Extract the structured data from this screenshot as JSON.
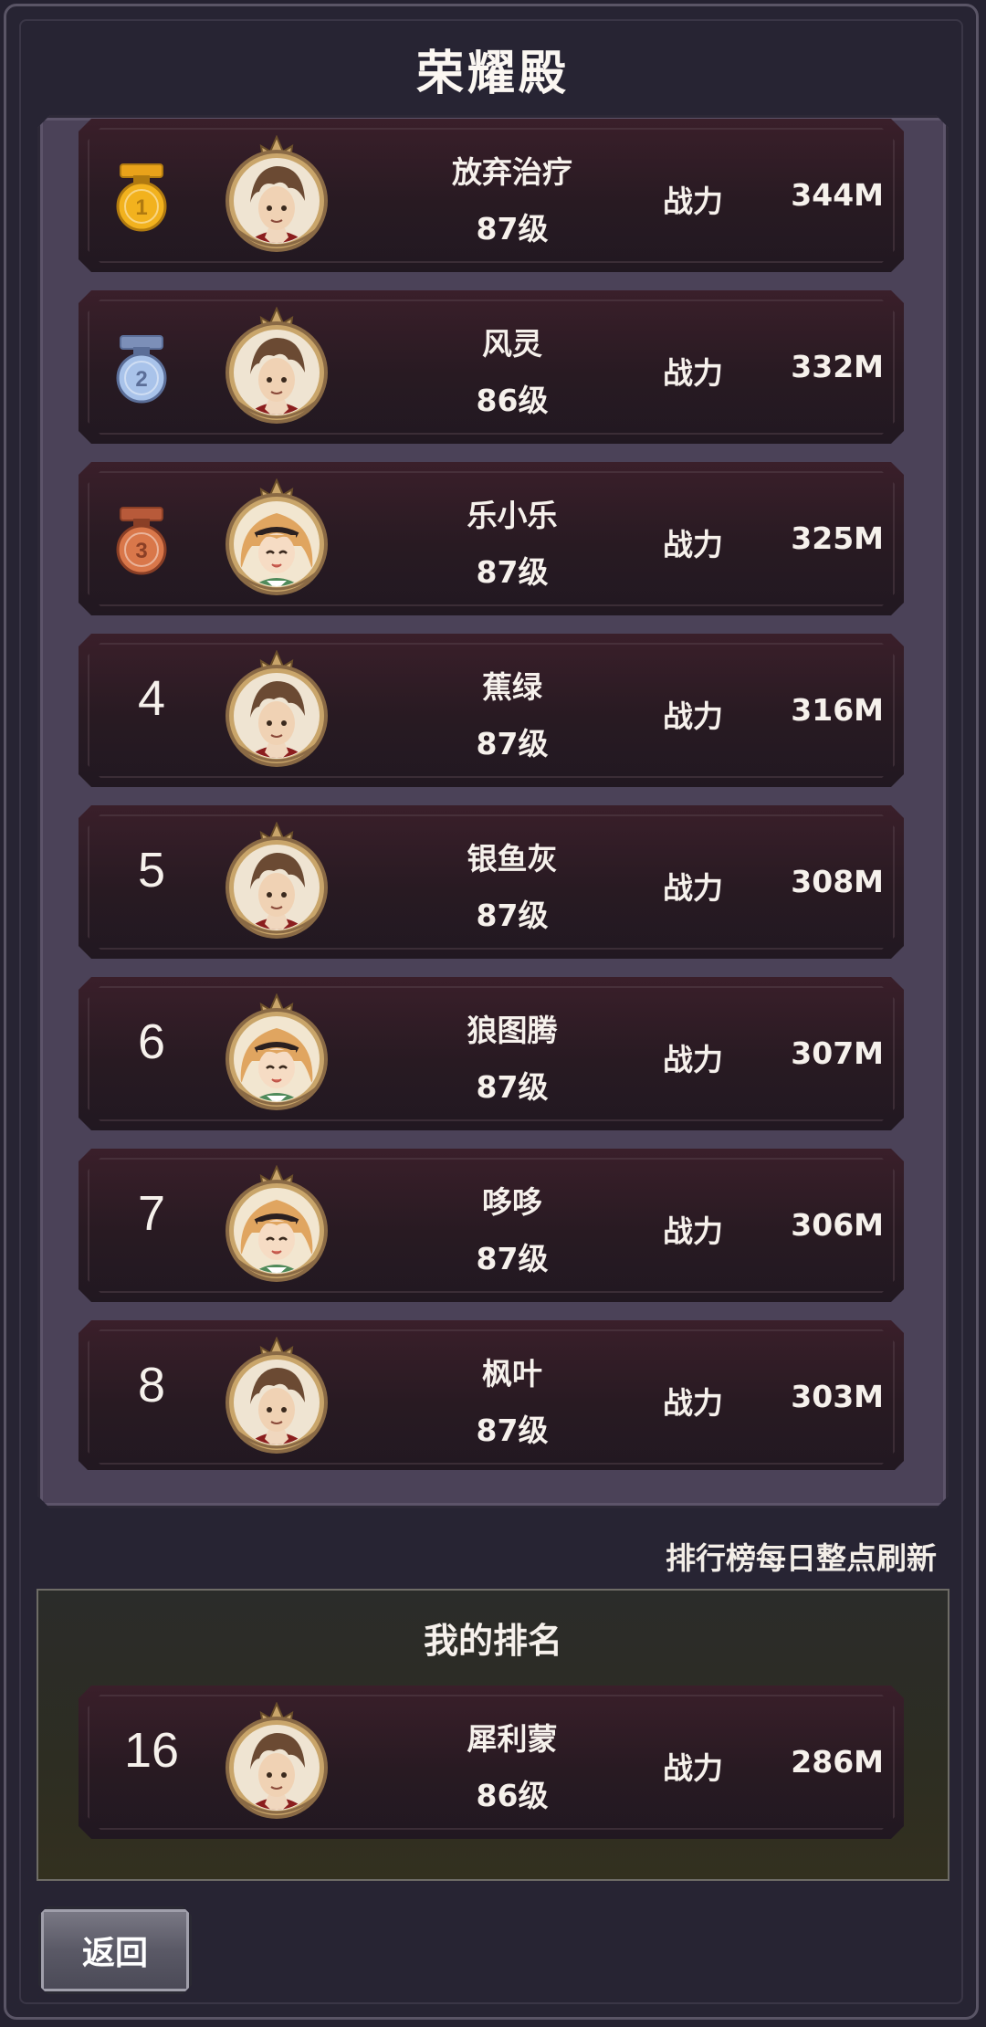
{
  "page_title": "荣耀殿",
  "power_label": "战力",
  "rankings": [
    {
      "rank": "1",
      "medal": "gold",
      "avatar": "male-brown-hair",
      "name": "放弃治疗",
      "level": "87级",
      "power": "344M"
    },
    {
      "rank": "2",
      "medal": "silver",
      "avatar": "male-brown-hair",
      "name": "风灵",
      "level": "86级",
      "power": "332M"
    },
    {
      "rank": "3",
      "medal": "bronze",
      "avatar": "female-blonde-hair",
      "name": "乐小乐",
      "level": "87级",
      "power": "325M"
    },
    {
      "rank": "4",
      "medal": "",
      "avatar": "male-brown-hair",
      "name": "蕉绿",
      "level": "87级",
      "power": "316M"
    },
    {
      "rank": "5",
      "medal": "",
      "avatar": "male-brown-hair",
      "name": "银鱼灰",
      "level": "87级",
      "power": "308M"
    },
    {
      "rank": "6",
      "medal": "",
      "avatar": "female-blonde-hair",
      "name": "狼图腾",
      "level": "87级",
      "power": "307M"
    },
    {
      "rank": "7",
      "medal": "",
      "avatar": "female-blonde-hair",
      "name": "哆哆",
      "level": "87级",
      "power": "306M"
    },
    {
      "rank": "8",
      "medal": "",
      "avatar": "male-brown-hair",
      "name": "枫叶",
      "level": "87级",
      "power": "303M"
    }
  ],
  "refresh_notice": "排行榜每日整点刷新",
  "my_rank": {
    "title": "我的排名",
    "rank": "16",
    "avatar": "male-brown-hair",
    "name": "犀利蒙",
    "level": "86级",
    "power": "286M"
  },
  "back_button_label": "返回",
  "colors": {
    "background": "#252231",
    "panel": "#4b4258",
    "row": "#2a1b24",
    "my_panel": "#2d2d22",
    "gold": "#f2b21e",
    "silver": "#a9c3ea",
    "bronze": "#d9774a"
  }
}
